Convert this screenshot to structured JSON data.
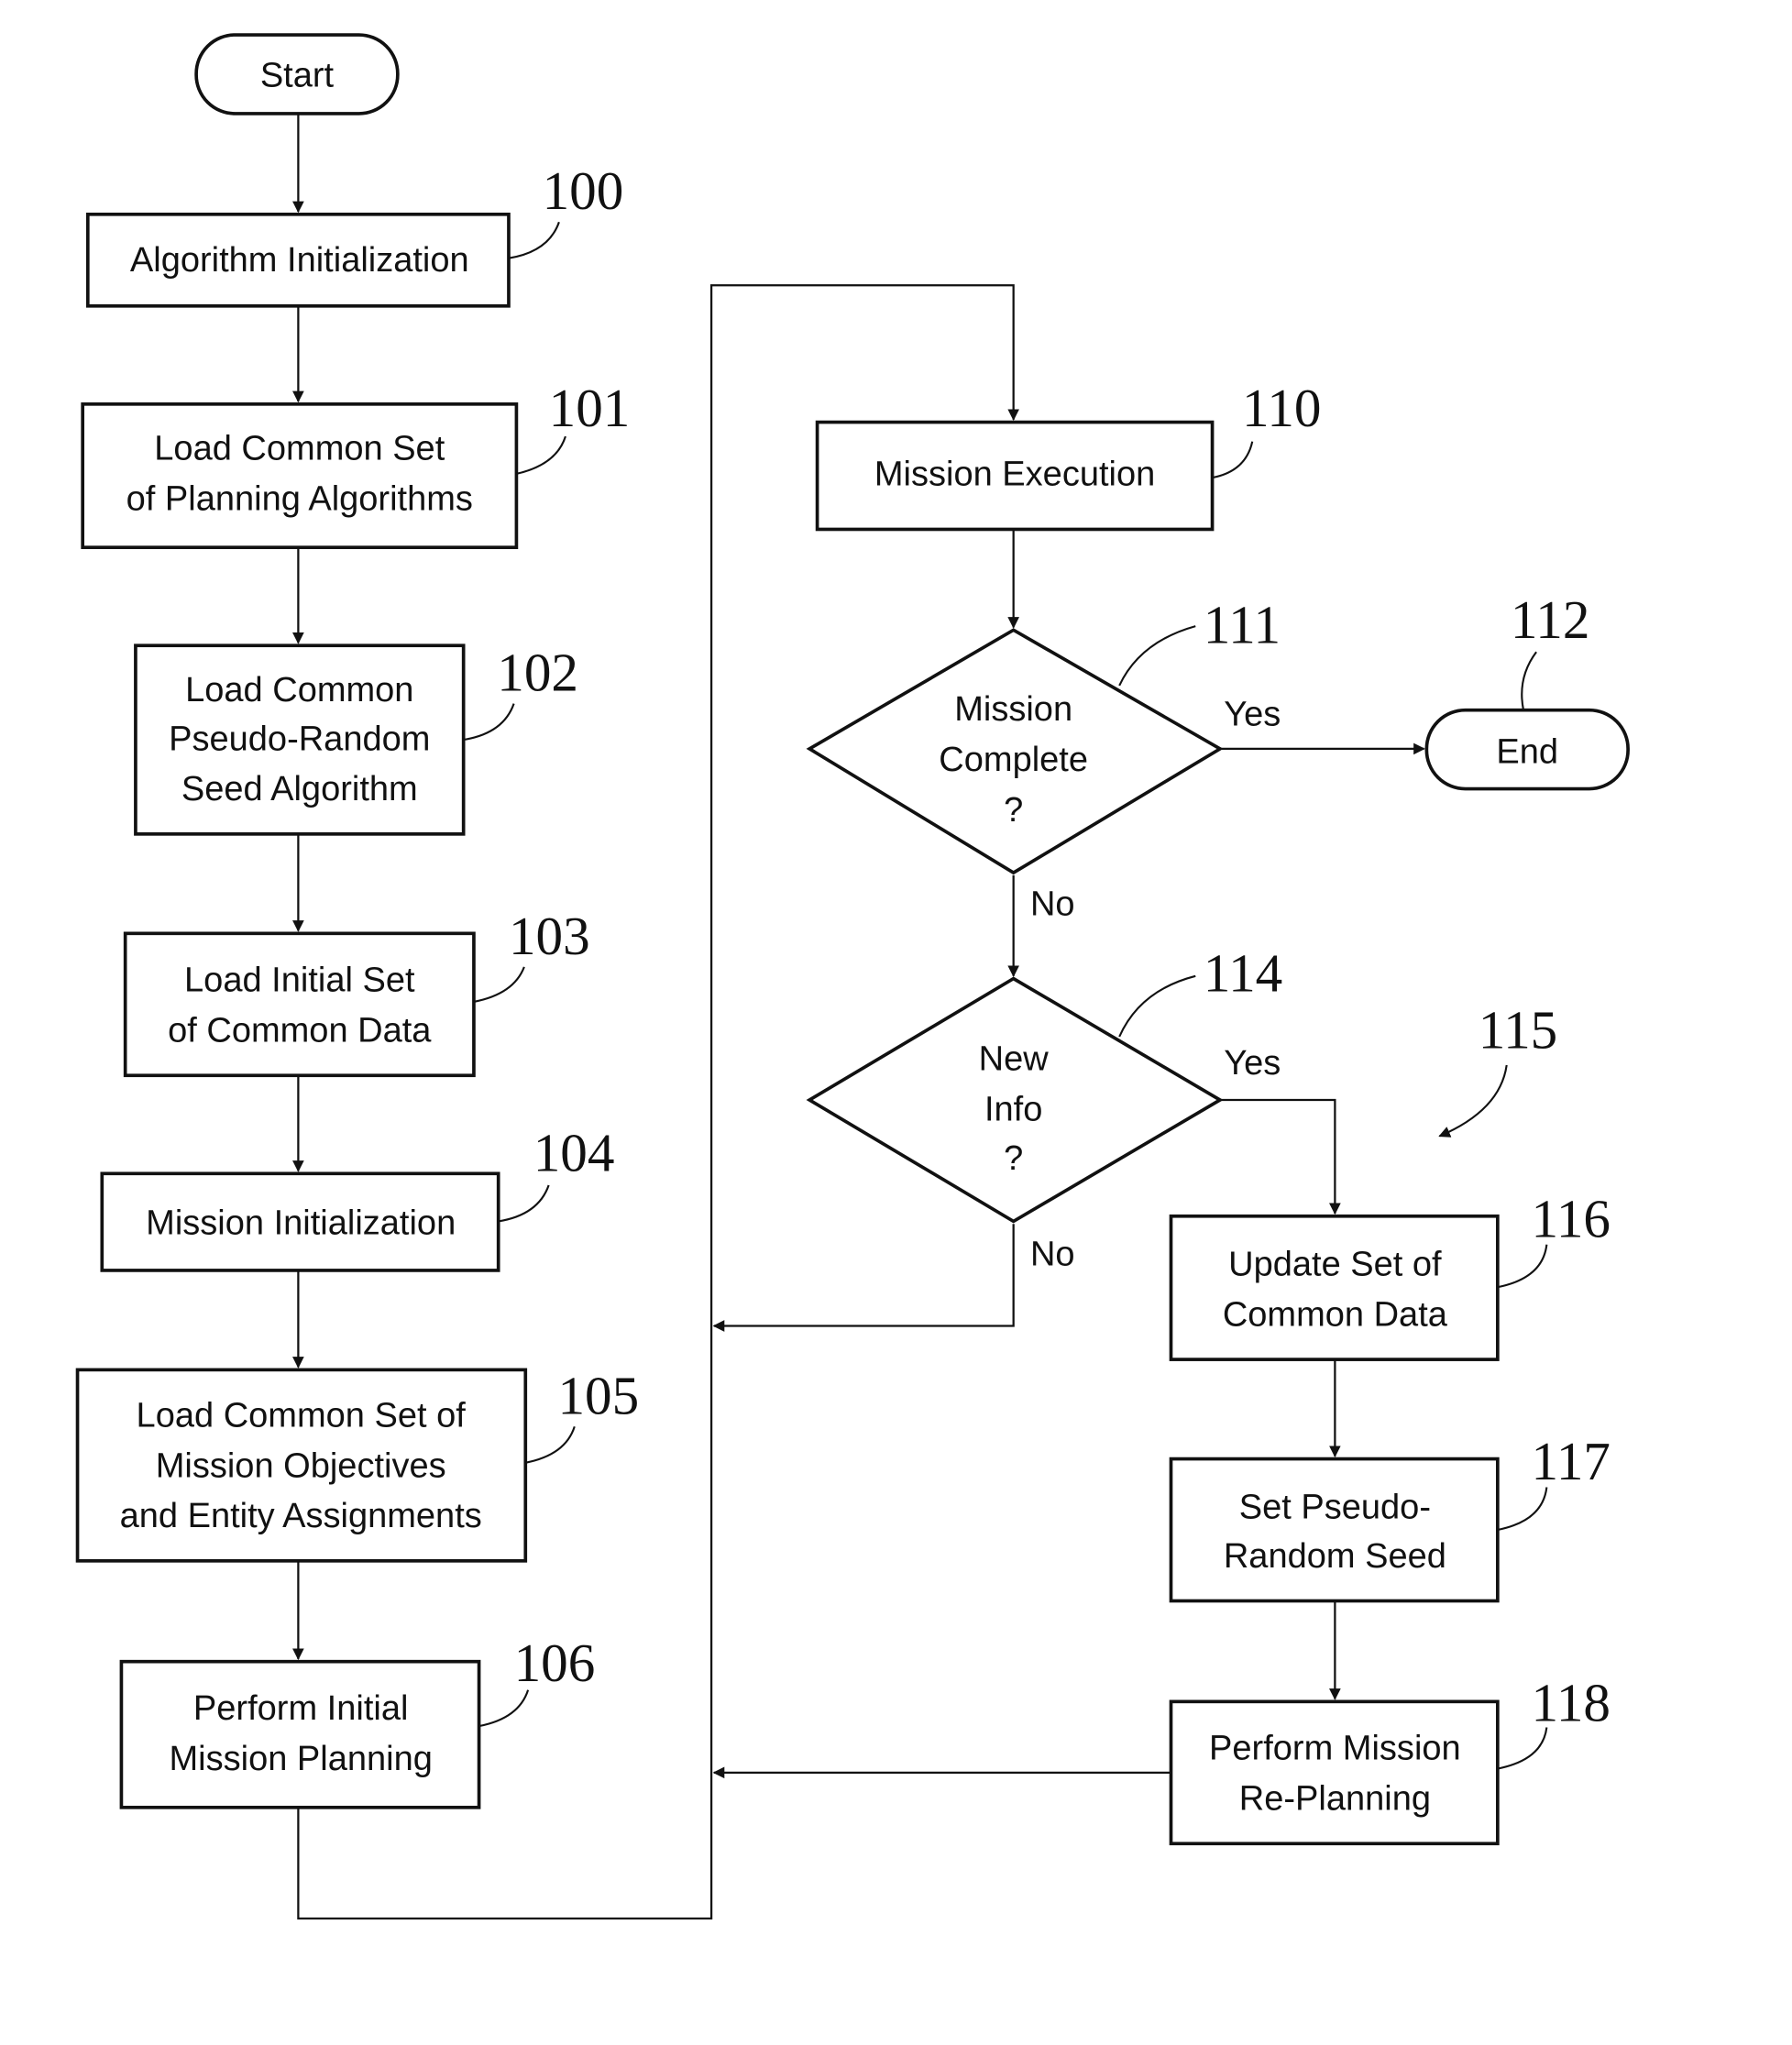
{
  "diagram": {
    "type": "flowchart",
    "terminals": {
      "start": "Start",
      "end": "End"
    },
    "steps": [
      {
        "ref": "100",
        "lines": [
          "Algorithm Initialization"
        ]
      },
      {
        "ref": "101",
        "lines": [
          "Load Common Set",
          "of Planning Algorithms"
        ]
      },
      {
        "ref": "102",
        "lines": [
          "Load Common",
          "Pseudo-Random",
          "Seed Algorithm"
        ]
      },
      {
        "ref": "103",
        "lines": [
          "Load Initial Set",
          "of Common Data"
        ]
      },
      {
        "ref": "104",
        "lines": [
          "Mission Initialization"
        ]
      },
      {
        "ref": "105",
        "lines": [
          "Load Common Set of",
          "Mission Objectives",
          "and Entity Assignments"
        ]
      },
      {
        "ref": "106",
        "lines": [
          "Perform Initial",
          "Mission Planning"
        ]
      },
      {
        "ref": "110",
        "lines": [
          "Mission Execution"
        ]
      },
      {
        "ref": "116",
        "lines": [
          "Update Set of",
          "Common Data"
        ]
      },
      {
        "ref": "117",
        "lines": [
          "Set Pseudo-",
          "Random Seed"
        ]
      },
      {
        "ref": "118",
        "lines": [
          "Perform Mission",
          "Re-Planning"
        ]
      }
    ],
    "decisions": [
      {
        "ref": "111",
        "lines": [
          "Mission",
          "Complete",
          "?"
        ],
        "yes": "Yes",
        "no": "No"
      },
      {
        "ref": "114",
        "lines": [
          "New",
          "Info",
          "?"
        ],
        "yes": "Yes",
        "no": "No"
      }
    ],
    "end_ref": "112",
    "group_ref": "115"
  }
}
